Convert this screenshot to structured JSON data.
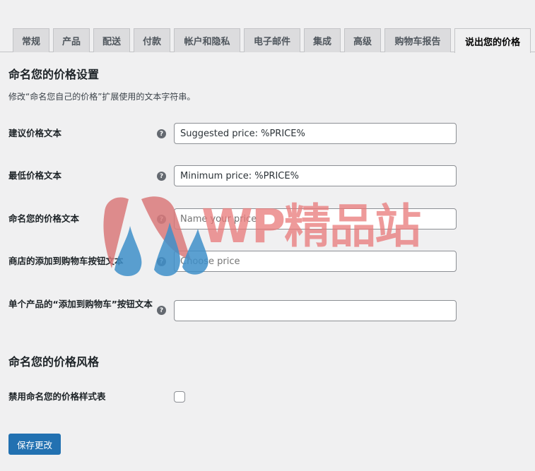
{
  "tabs": [
    {
      "label": "常规"
    },
    {
      "label": "产品"
    },
    {
      "label": "配送"
    },
    {
      "label": "付款"
    },
    {
      "label": "帐户和隐私"
    },
    {
      "label": "电子邮件"
    },
    {
      "label": "集成"
    },
    {
      "label": "高级"
    },
    {
      "label": "购物车报告"
    },
    {
      "label": "说出您的价格",
      "active": true
    }
  ],
  "section1": {
    "title": "命名您的价格设置",
    "description": "修改“命名您自己的价格”扩展使用的文本字符串。"
  },
  "fields": [
    {
      "label": "建议价格文本",
      "value": "Suggested price: %PRICE%",
      "placeholder": ""
    },
    {
      "label": "最低价格文本",
      "value": "Minimum price: %PRICE%",
      "placeholder": ""
    },
    {
      "label": "命名您的价格文本",
      "value": "",
      "placeholder": "Name your price"
    },
    {
      "label": "商店的添加到购物车按钮文本",
      "value": "",
      "placeholder": "Choose price"
    },
    {
      "label": "单个产品的“添加到购物车”按钮文本",
      "value": "",
      "placeholder": ""
    }
  ],
  "help_icon_glyph": "?",
  "section2": {
    "title": "命名您的价格风格",
    "checkbox_label": "禁用命名您的价格样式表",
    "checkbox_checked": false
  },
  "save_label": "保存更改",
  "watermark": {
    "text": "WP精品站",
    "colors": {
      "red": "#d9797a",
      "blue": "#3e8fc9"
    }
  },
  "colors": {
    "accent": "#2271b1",
    "page_bg": "#f0f0f1"
  }
}
